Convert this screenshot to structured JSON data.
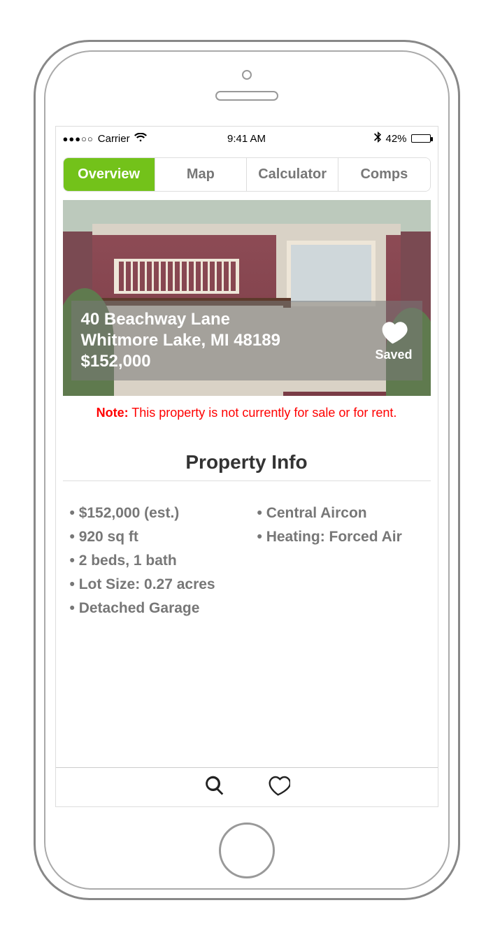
{
  "status_bar": {
    "signal_dots": "●●●○○",
    "carrier": "Carrier",
    "time": "9:41 AM",
    "battery_pct": "42%"
  },
  "tabs": {
    "items": [
      {
        "label": "Overview",
        "active": true
      },
      {
        "label": "Map",
        "active": false
      },
      {
        "label": "Calculator",
        "active": false
      },
      {
        "label": "Comps",
        "active": false
      }
    ]
  },
  "hero": {
    "address_line1": "40 Beachway Lane",
    "address_line2": "Whitmore Lake, MI 48189",
    "price": "$152,000",
    "saved_label": "Saved"
  },
  "note": {
    "prefix": "Note:",
    "text": "This property is not currently for sale or for rent."
  },
  "section_title": "Property Info",
  "info": {
    "col1": [
      "$152,000 (est.)",
      "920 sq ft",
      "2 beds, 1 bath",
      "Lot Size: 0.27 acres",
      "Detached Garage"
    ],
    "col2": [
      "Central Aircon",
      "Heating: Forced Air"
    ]
  },
  "colors": {
    "accent_green": "#73c21a",
    "note_red": "#ff0000"
  }
}
